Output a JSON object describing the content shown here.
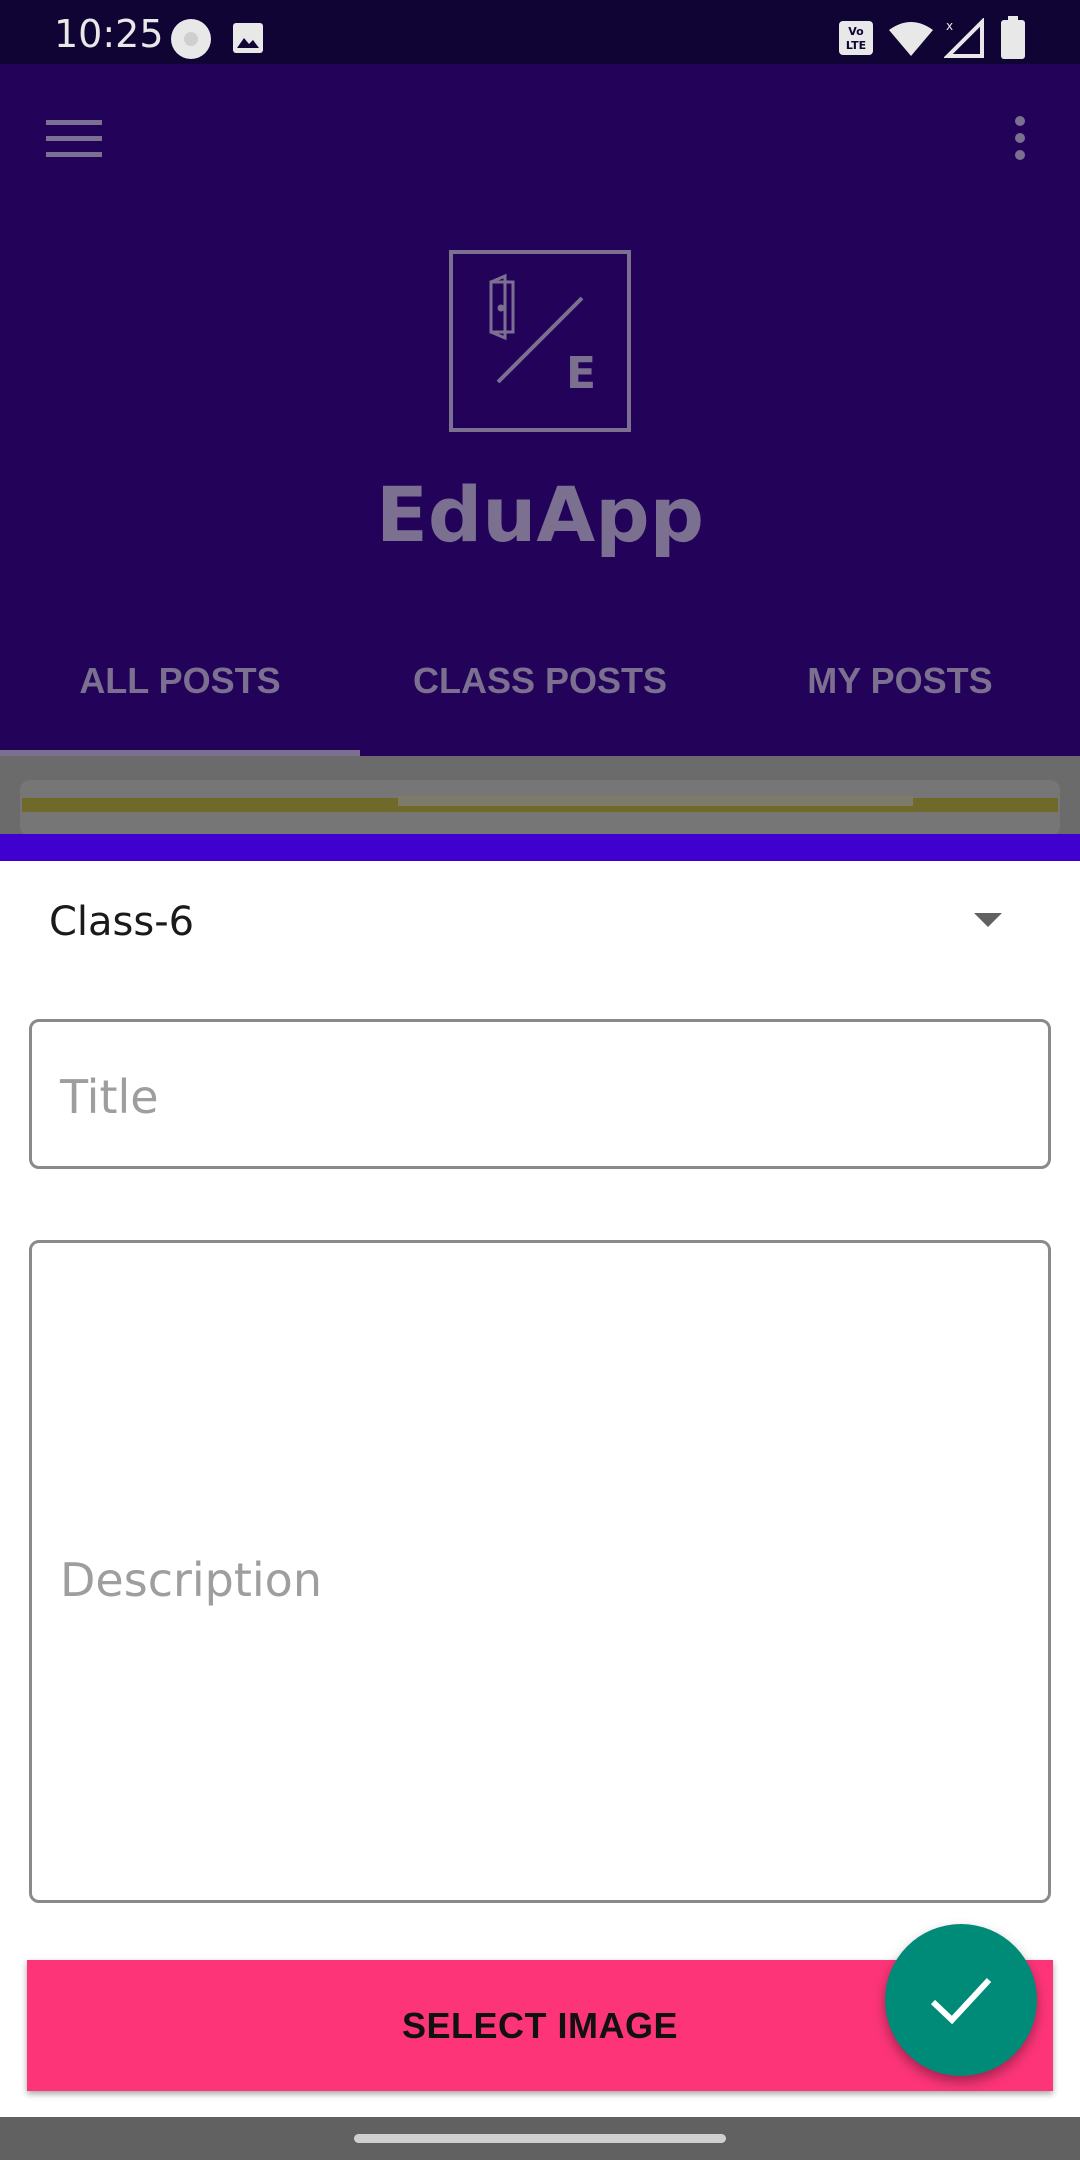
{
  "status_bar": {
    "time": "10:25",
    "icons": [
      "app-notification-icon",
      "gallery-icon",
      "volte-icon",
      "wifi-icon",
      "signal-icon",
      "battery-icon"
    ]
  },
  "app_bar": {
    "title": "EduApp",
    "logo_letter": "E",
    "menu_icon": "hamburger-menu-icon",
    "overflow_icon": "more-vert-icon"
  },
  "tabs": [
    {
      "label": "ALL POSTS",
      "selected": true
    },
    {
      "label": "CLASS POSTS",
      "selected": false
    },
    {
      "label": "MY POSTS",
      "selected": false
    }
  ],
  "sheet": {
    "class_spinner": {
      "value": "Class-6"
    },
    "title_field": {
      "placeholder": "Title",
      "value": ""
    },
    "description_field": {
      "placeholder": "Description",
      "value": ""
    },
    "select_image_label": "SELECT IMAGE"
  },
  "colors": {
    "app_bar": "#23035a",
    "sheet_accent": "#3f00d0",
    "select_button": "#fd3578",
    "fab": "#008a78"
  }
}
